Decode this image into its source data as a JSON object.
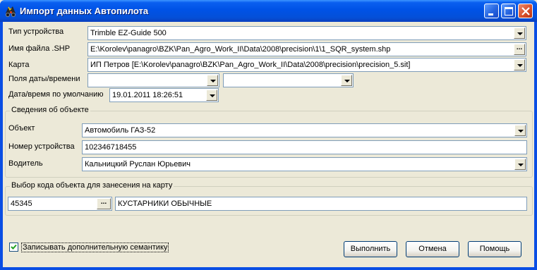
{
  "window": {
    "title": "Импорт данных Автопилота",
    "icons": {
      "app": "tractor-icon",
      "minimize": "minimize-icon",
      "maximize": "maximize-icon",
      "close": "close-icon"
    }
  },
  "device_type": {
    "label": "Тип устройства",
    "value": "Trimble EZ-Guide 500"
  },
  "shp_file": {
    "label": "Имя файла .SHP",
    "value": "E:\\Korolev\\panagro\\BZK\\Pan_Agro_Work_II\\Data\\2008\\precision\\1\\1_SQR_system.shp",
    "browse": "..."
  },
  "map": {
    "label": "Карта",
    "value": "ИП Петров [E:\\Korolev\\panagro\\BZK\\Pan_Agro_Work_II\\Data\\2008\\precision\\precision_5.sit]"
  },
  "datetime_fields": {
    "label": "Поля даты/времени",
    "value1": "",
    "value2": ""
  },
  "default_datetime": {
    "label": "Дата/время по умолчанию",
    "value": "19.01.2011 18:26:51"
  },
  "object_info": {
    "title": "Сведения об объекте",
    "object": {
      "label": "Объект",
      "value": "Автомобиль ГАЗ-52"
    },
    "device_number": {
      "label": "Номер устройства",
      "value": "102346718455"
    },
    "driver": {
      "label": "Водитель",
      "value": "Кальницкий Руслан Юрьевич"
    }
  },
  "object_code": {
    "title": "Выбор кода объекта для занесения на карту",
    "code": "45345",
    "browse": "...",
    "name": "КУСТАРНИКИ ОБЫЧНЫЕ"
  },
  "semantics_checkbox": {
    "label": "Записывать дополнительную семантику",
    "checked": true
  },
  "buttons": {
    "run": "Выполнить",
    "cancel": "Отмена",
    "help": "Помощь"
  }
}
